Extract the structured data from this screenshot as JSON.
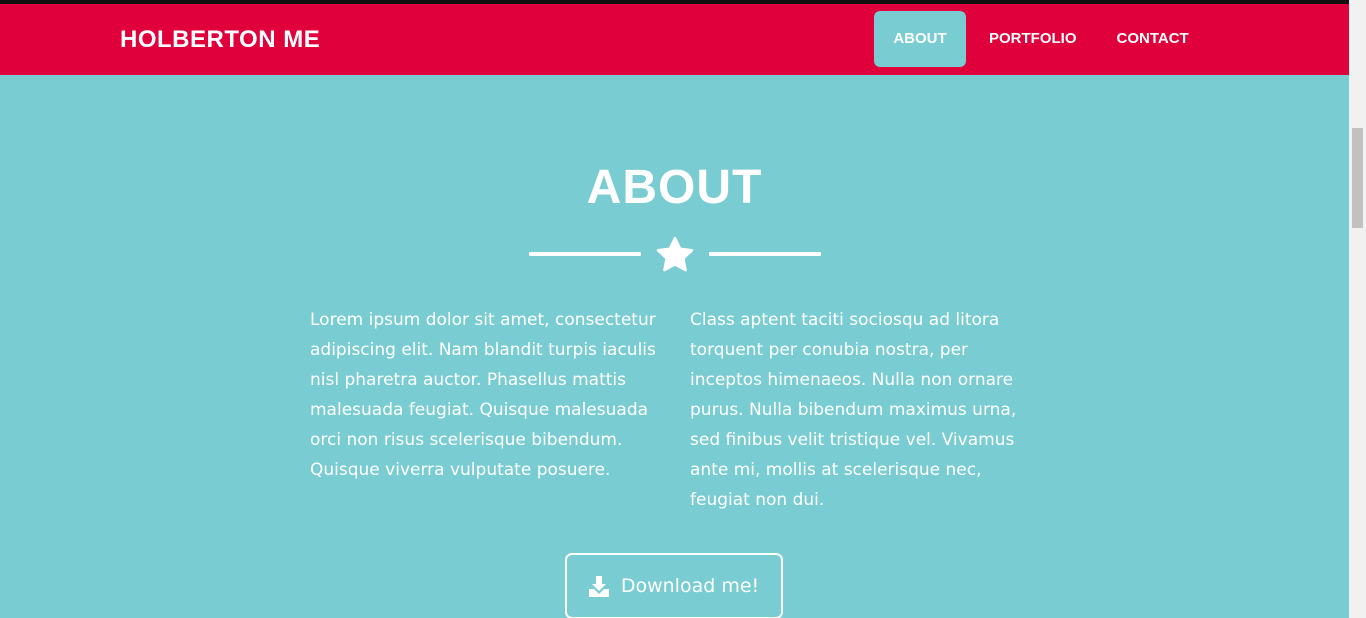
{
  "navbar": {
    "brand": "HOLBERTON ME",
    "items": [
      {
        "label": "ABOUT",
        "active": true
      },
      {
        "label": "PORTFOLIO",
        "active": false
      },
      {
        "label": "CONTACT",
        "active": false
      }
    ],
    "color": "#e0003b"
  },
  "about": {
    "title": "ABOUT",
    "divider_icon": "star-icon",
    "paragraphs": [
      "Lorem ipsum dolor sit amet, consectetur adipiscing elit. Nam blandit turpis iaculis nisl pharetra auctor. Phasellus mattis malesuada feugiat. Quisque malesuada orci non risus scelerisque bibendum. Quisque viverra vulputate posuere.",
      "Class aptent taciti sociosqu ad litora torquent per conubia nostra, per inceptos himenaeos. Nulla non ornare purus. Nulla bibendum maximus urna, sed finibus velit tristique vel. Vivamus ante mi, mollis at scelerisque nec, feugiat non dui."
    ],
    "download_label": "Download me!",
    "download_icon": "download-icon",
    "background": "#78ccd2"
  }
}
